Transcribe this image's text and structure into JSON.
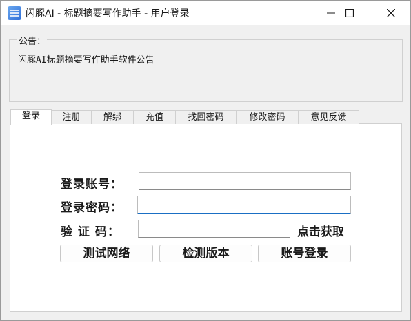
{
  "window": {
    "title": "闪豚AI - 标题摘要写作助手 - 用户登录"
  },
  "notice": {
    "label": "公告：",
    "text": "闪豚AI标题摘要写作助手软件公告"
  },
  "tabs": [
    "登录",
    "注册",
    "解绑",
    "充值",
    "找回密码",
    "修改密码",
    "意见反馈"
  ],
  "login": {
    "account_label": "登录账号：",
    "account_value": "",
    "password_label": "登录密码：",
    "password_value": "",
    "captcha_label": "验 证 码：",
    "captcha_value": "",
    "captcha_link": "点击获取",
    "buttons": {
      "test_network": "测试网络",
      "check_version": "检测版本",
      "login": "账号登录"
    }
  }
}
